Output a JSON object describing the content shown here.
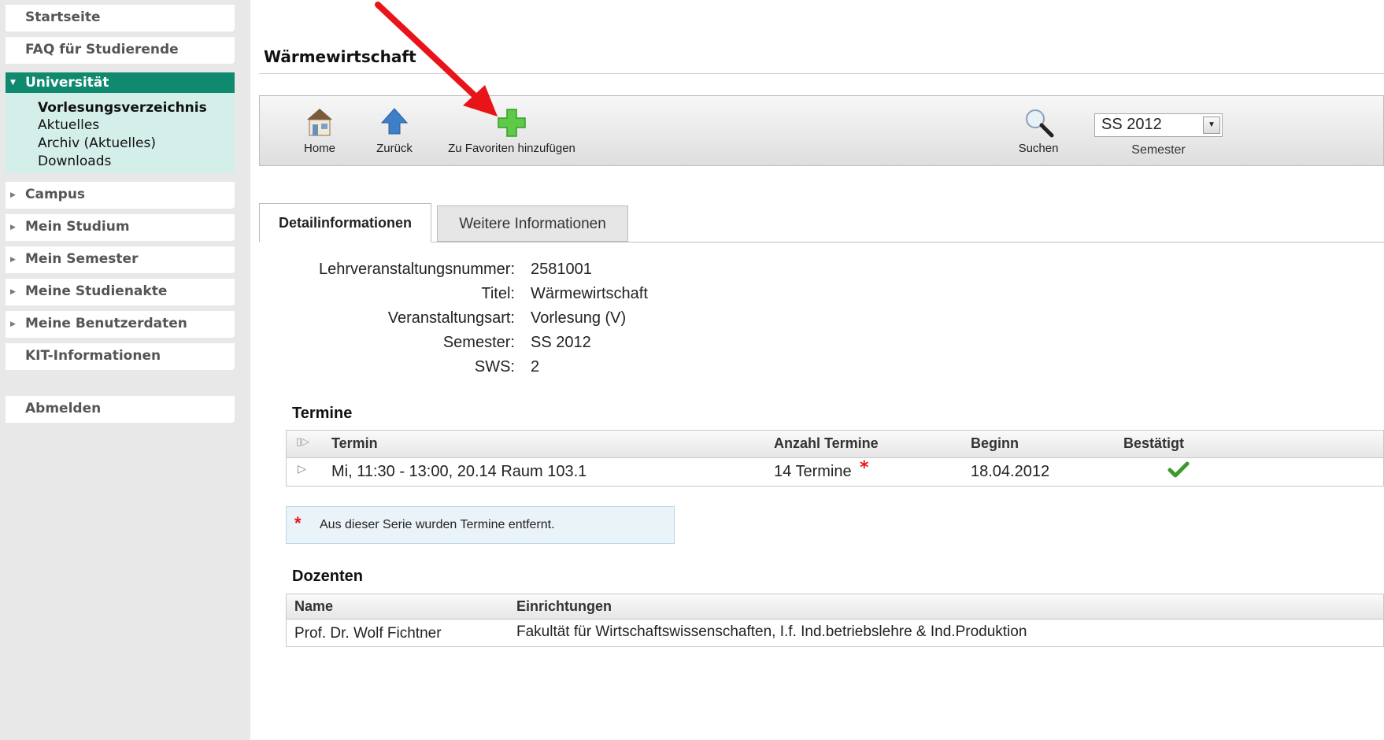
{
  "sidebar": {
    "items_top": [
      {
        "label": "Startseite"
      },
      {
        "label": "FAQ für Studierende"
      }
    ],
    "active": {
      "label": "Universität"
    },
    "subitems": [
      {
        "label": "Vorlesungsverzeichnis",
        "current": true
      },
      {
        "label": "Aktuelles"
      },
      {
        "label": "Archiv (Aktuelles)"
      },
      {
        "label": "Downloads"
      }
    ],
    "items_bottom": [
      {
        "label": "Campus"
      },
      {
        "label": "Mein Studium"
      },
      {
        "label": "Mein Semester"
      },
      {
        "label": "Meine Studienakte"
      },
      {
        "label": "Meine Benutzerdaten"
      },
      {
        "label": "KIT-Informationen"
      }
    ],
    "logout": {
      "label": "Abmelden"
    }
  },
  "page": {
    "title": "Wärmewirtschaft"
  },
  "toolbar": {
    "home_label": "Home",
    "back_label": "Zurück",
    "favorites_label": "Zu Favoriten hinzufügen",
    "search_label": "Suchen",
    "semester_value": "SS 2012",
    "semester_caption": "Semester"
  },
  "tabs": [
    {
      "label": "Detailinformationen",
      "active": true
    },
    {
      "label": "Weitere Informationen",
      "active": false
    }
  ],
  "details": {
    "lv_nummer_label": "Lehrveranstaltungsnummer:",
    "lv_nummer_value": "2581001",
    "titel_label": "Titel:",
    "titel_value": "Wärmewirtschaft",
    "art_label": "Veranstaltungsart:",
    "art_value": "Vorlesung (V)",
    "semester_label": "Semester:",
    "semester_value": "SS 2012",
    "sws_label": "SWS:",
    "sws_value": "2"
  },
  "termine": {
    "heading": "Termine",
    "columns": [
      "Termin",
      "Anzahl Termine",
      "Beginn",
      "Bestätigt"
    ],
    "rows": [
      {
        "termin": "Mi, 11:30 - 13:00, 20.14 Raum 103.1",
        "anzahl": "14 Termine",
        "beginn": "18.04.2012"
      }
    ],
    "hint": "Aus dieser Serie wurden Termine entfernt.",
    "star": "*"
  },
  "dozenten": {
    "heading": "Dozenten",
    "columns": [
      "Name",
      "Einrichtungen"
    ],
    "rows": [
      {
        "name": "Prof. Dr. Wolf Fichtner",
        "einrichtung": "Fakultät für Wirtschaftswissenschaften, I.f. Ind.betriebslehre & Ind.Produktion"
      }
    ]
  },
  "colors": {
    "active_nav": "#0f8a6e",
    "arrow": "#e8141a",
    "check": "#3a9a2a"
  }
}
